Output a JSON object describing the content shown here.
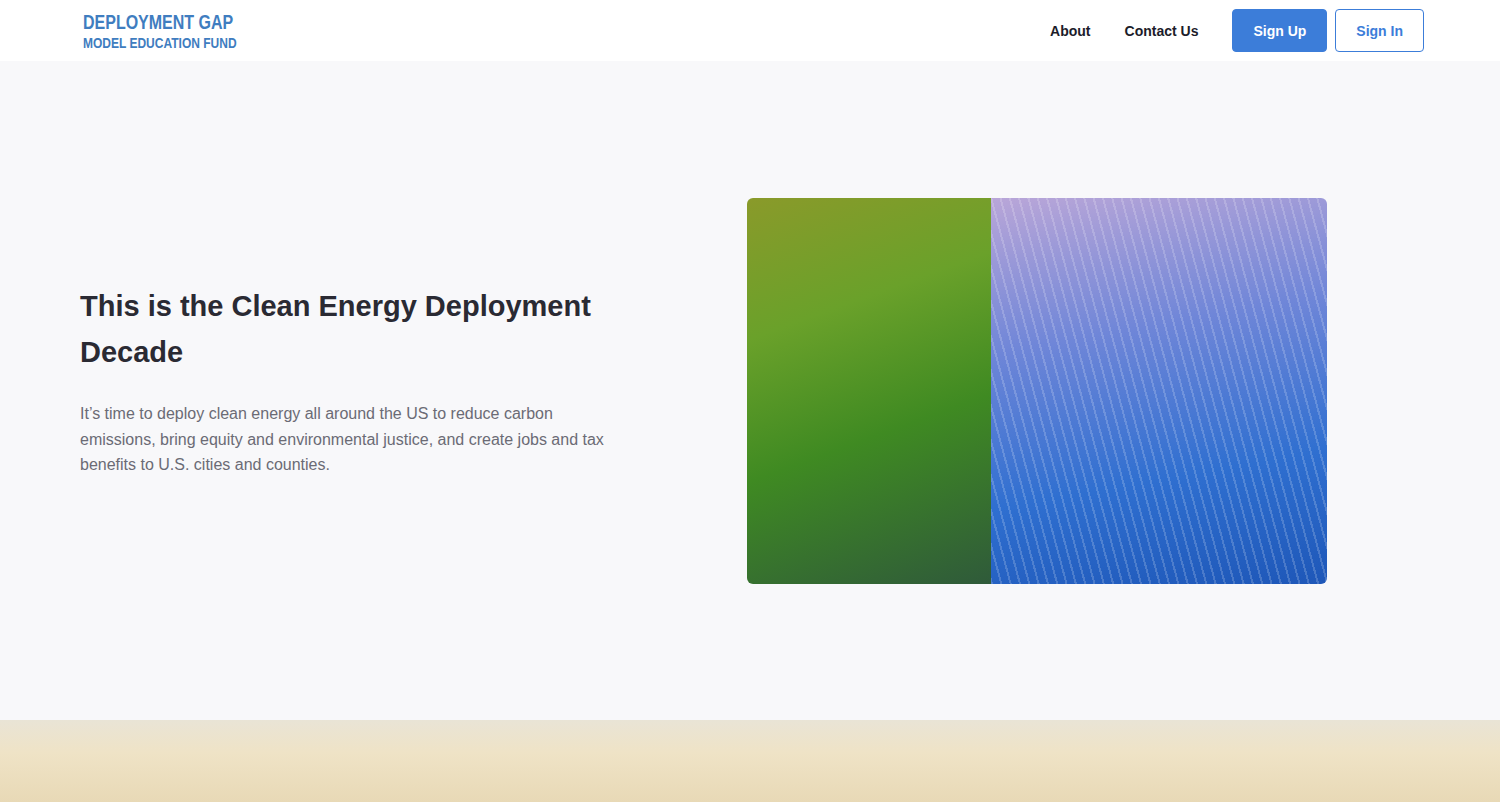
{
  "header": {
    "logo": {
      "line1": "DEPLOYMENT GAP",
      "line2": "MODEL EDUCATION FUND"
    },
    "nav": [
      {
        "label": "About"
      },
      {
        "label": "Contact Us"
      }
    ],
    "buttons": [
      {
        "label": "Sign Up",
        "kind": "primary"
      },
      {
        "label": "Sign In",
        "kind": "outline"
      }
    ]
  },
  "hero": {
    "title": "This is the Clean Energy Deployment Decade",
    "body": "It’s time to deploy clean energy all around the US to reduce carbon emissions, bring equity and environmental justice, and create jobs and tax benefits to U.S. cities and counties."
  }
}
